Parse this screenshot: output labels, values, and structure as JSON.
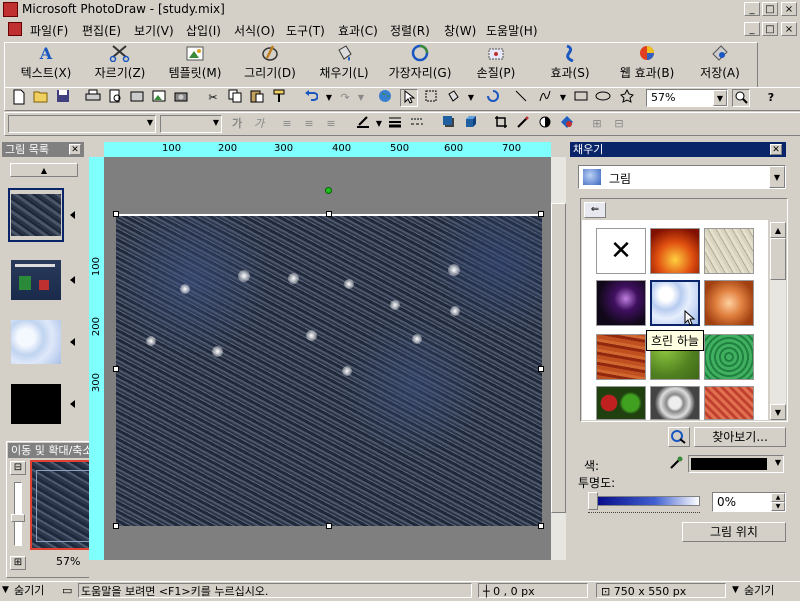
{
  "window": {
    "title": "Microsoft PhotoDraw - [study.mix]",
    "min": "_",
    "max": "□",
    "close": "×"
  },
  "menu": [
    "파일(F)",
    "편집(E)",
    "보기(V)",
    "삽입(I)",
    "서식(O)",
    "도구(T)",
    "효과(C)",
    "정렬(R)",
    "창(W)",
    "도움말(H)"
  ],
  "bigbar": [
    {
      "label": "텍스트(X)",
      "icon": "text-icon"
    },
    {
      "label": "자르기(Z)",
      "icon": "scissors-icon"
    },
    {
      "label": "템플릿(M)",
      "icon": "template-icon"
    },
    {
      "label": "그리기(D)",
      "icon": "pen-icon"
    },
    {
      "label": "채우기(L)",
      "icon": "fill-bucket-icon"
    },
    {
      "label": "가장자리(G)",
      "icon": "edge-icon"
    },
    {
      "label": "손질(P)",
      "icon": "retouch-icon"
    },
    {
      "label": "효과(S)",
      "icon": "effects-icon"
    },
    {
      "label": "웹 효과(B)",
      "icon": "web-effects-icon"
    },
    {
      "label": "저장(A)",
      "icon": "save-icon"
    }
  ],
  "toolbar": {
    "zoom": "57%",
    "font_name": "",
    "font_size": "",
    "bold": "가",
    "italic": "가"
  },
  "left_panel": {
    "title": "그림 목록",
    "thumbs": [
      "thumb-cracked-blue",
      "thumb-christmas",
      "thumb-clouds",
      "thumb-black"
    ]
  },
  "pan_zoom": {
    "title": "이동 및 확대/축소",
    "zoom": "57%"
  },
  "ruler": {
    "top_ticks": [
      "100",
      "200",
      "300",
      "400",
      "500",
      "600",
      "700"
    ],
    "left_ticks": [
      "100",
      "200",
      "300"
    ]
  },
  "fill_panel": {
    "title": "채우기",
    "mode": "그림",
    "tooltip": "흐린 하늘",
    "browse_button": "찾아보기...",
    "color_label": "색:",
    "opacity_label": "투명도:",
    "opacity_value": "0%",
    "position_button": "그림 위치",
    "hide_label": "숨기기"
  },
  "status": {
    "hide": "숨기기",
    "help": "도움말을 보려면 <F1>키를 누르십시오.",
    "coords": "0 , 0  px",
    "size": "750 x 550  px",
    "hide2": "숨기기"
  },
  "colors": {
    "ruler": "#80ffff",
    "title_bar_inactive": "#808080",
    "selection": "#000080"
  }
}
